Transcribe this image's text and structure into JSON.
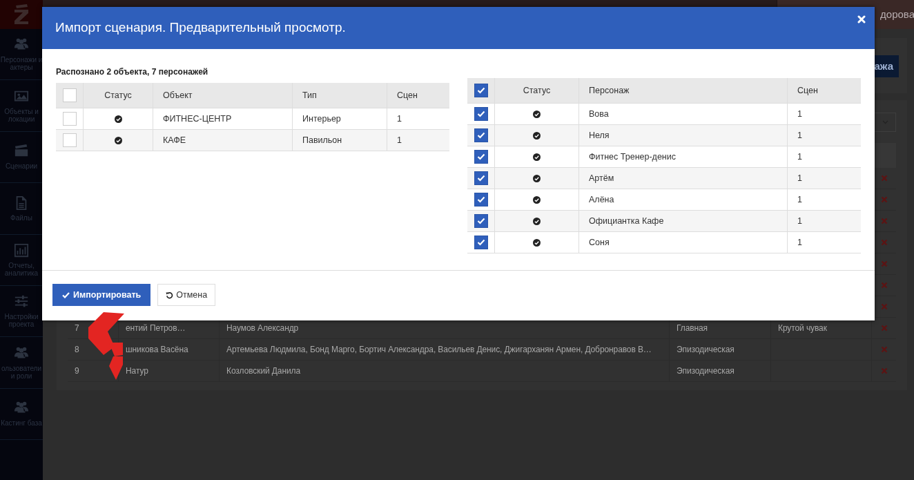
{
  "sidebar": {
    "items": [
      {
        "label": "Персонажи и актеры"
      },
      {
        "label": "Объекты и локации"
      },
      {
        "label": "Сценарии"
      },
      {
        "label": "Файлы"
      },
      {
        "label": "Отчеты, аналитика"
      },
      {
        "label": "Настройки проекта"
      },
      {
        "label": "ользователи и роли"
      },
      {
        "label": "Кастинг база"
      }
    ]
  },
  "header": {
    "user_name": "дорова"
  },
  "page": {
    "add_button": "ажа",
    "table": {
      "rows": [
        {
          "kind": "covered"
        },
        {
          "kind": "covered"
        },
        {
          "kind": "covered"
        },
        {
          "kind": "covered"
        },
        {
          "kind": "covered"
        },
        {
          "kind": "covered"
        },
        {
          "kind": "covered"
        },
        {
          "kind": "row",
          "number": "7",
          "name": "ентий Петров…",
          "actors": "Наумов Александр",
          "role": "Главная",
          "note": "Крутой чувак"
        },
        {
          "kind": "row",
          "number": "8",
          "name": "шникова Васёна",
          "actors": "Артемьева Людмила, Бонд Марго, Бортич Александра, Васильев Денис, Джигарханян Армен, Добронравов В…",
          "role": "Эпизодическая"
        },
        {
          "kind": "row",
          "number": "9",
          "name": "Натур",
          "actors": "Козловский Данила",
          "role": "Эпизодическая"
        }
      ]
    }
  },
  "modal": {
    "title": "Импорт сценария. Предварительный просмотр.",
    "summary": "Распознано 2 объекта, 7 персонажей",
    "objects_table": {
      "all_checked": false,
      "columns": [
        "Статус",
        "Объект",
        "Тип",
        "Сцен"
      ],
      "rows": [
        {
          "checked": false,
          "recognized": true,
          "object": "ФИТНЕС-ЦЕНТР",
          "type": "Интерьер",
          "scenes": "1"
        },
        {
          "checked": false,
          "recognized": true,
          "object": "КАФЕ",
          "type": "Павильон",
          "scenes": "1"
        }
      ]
    },
    "characters_table": {
      "all_checked": true,
      "columns": [
        "Статус",
        "Персонаж",
        "Сцен"
      ],
      "rows": [
        {
          "checked": true,
          "recognized": true,
          "name": "Вова",
          "scenes": "1"
        },
        {
          "checked": true,
          "recognized": true,
          "name": "Неля",
          "scenes": "1"
        },
        {
          "checked": true,
          "recognized": true,
          "name": "Фитнес Тренер-денис",
          "scenes": "1"
        },
        {
          "checked": true,
          "recognized": true,
          "name": "Артём",
          "scenes": "1"
        },
        {
          "checked": true,
          "recognized": true,
          "name": "Алёна",
          "scenes": "1"
        },
        {
          "checked": true,
          "recognized": true,
          "name": "Официантка Кафе",
          "scenes": "1"
        },
        {
          "checked": true,
          "recognized": true,
          "name": "Соня",
          "scenes": "1"
        }
      ]
    },
    "buttons": [
      {
        "kind": "primary",
        "label": "Импортировать"
      },
      {
        "kind": "secondary",
        "label": "Отмена"
      }
    ]
  }
}
